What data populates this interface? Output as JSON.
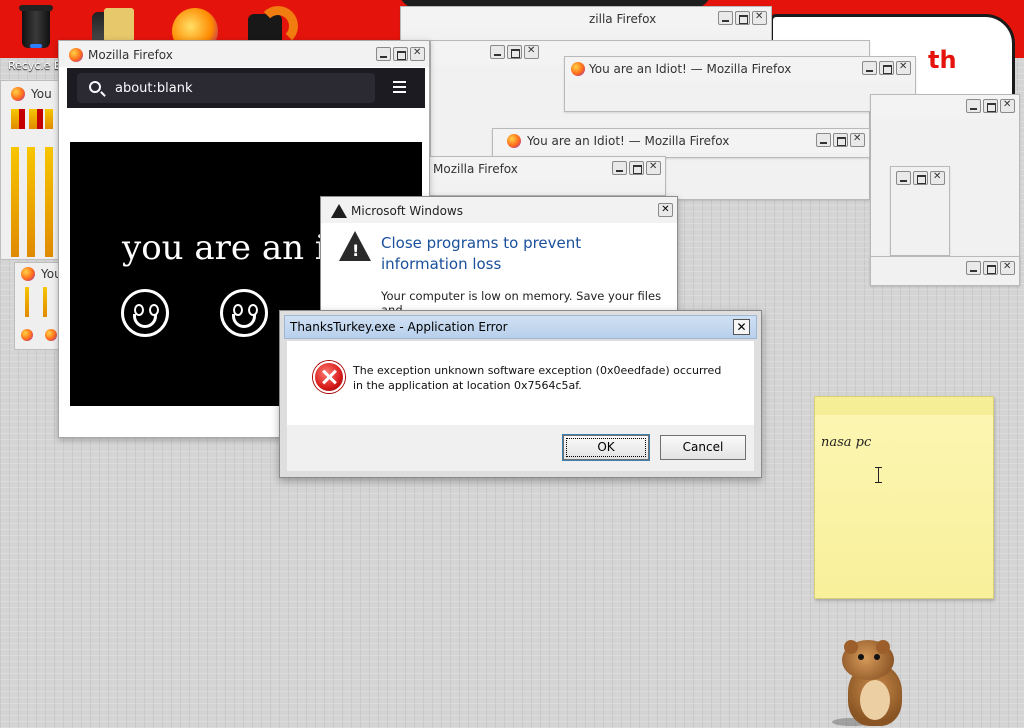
{
  "desktop": {
    "recycle_label": "Recycle B",
    "wallpaper_text": "th"
  },
  "ghost_windows": {
    "title_idiot": "You are an Idiot! — Mozilla Firefox",
    "title_firefox": "Mozilla Firefox",
    "title_ffx_cut": "zilla Firefox",
    "title_you": "You"
  },
  "firefox": {
    "title": "Mozilla Firefox",
    "url": "about:blank",
    "page_text": "you are an id"
  },
  "windows_dialog": {
    "title": "Microsoft Windows",
    "heading": "Close programs to prevent information loss",
    "body": "Your computer is low on memory. Save your files and"
  },
  "error_dialog": {
    "title": "ThanksTurkey.exe - Application Error",
    "message": "The exception unknown software exception (0x0eedfade) occurred in the application at location 0x7564c5af.",
    "ok_label": "OK",
    "cancel_label": "Cancel"
  },
  "sticky_note": {
    "text": "nasa pc"
  },
  "colors": {
    "wallpaper_red": "#e4140c",
    "link_blue": "#1a4f9c",
    "error_red": "#d71b1b",
    "sticky_yellow": "#fcf6b4"
  },
  "icons": [
    "firefox-icon",
    "search-icon",
    "menu-icon",
    "warning-icon",
    "error-icon",
    "close-icon",
    "minimize-icon",
    "maximize-icon"
  ]
}
